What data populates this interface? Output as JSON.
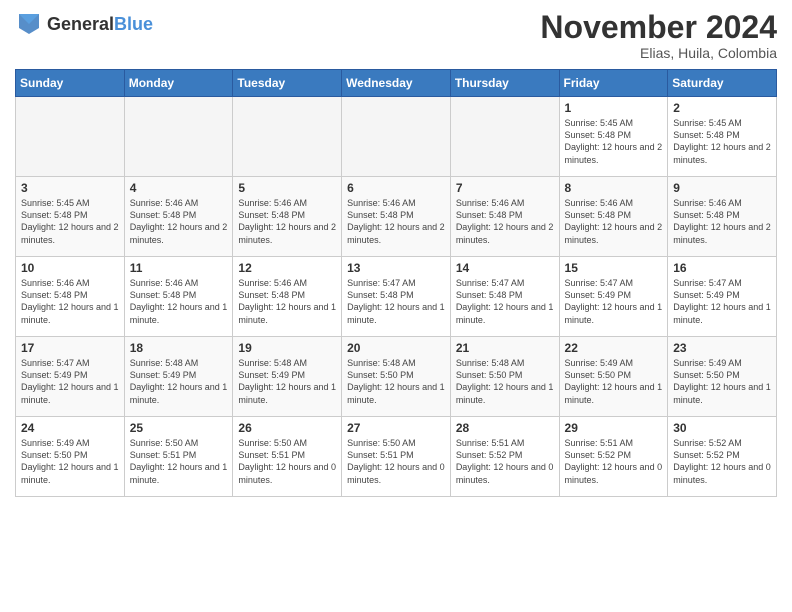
{
  "header": {
    "logo_general": "General",
    "logo_blue": "Blue",
    "month_title": "November 2024",
    "subtitle": "Elias, Huila, Colombia"
  },
  "days_of_week": [
    "Sunday",
    "Monday",
    "Tuesday",
    "Wednesday",
    "Thursday",
    "Friday",
    "Saturday"
  ],
  "weeks": [
    [
      {
        "day": "",
        "info": ""
      },
      {
        "day": "",
        "info": ""
      },
      {
        "day": "",
        "info": ""
      },
      {
        "day": "",
        "info": ""
      },
      {
        "day": "",
        "info": ""
      },
      {
        "day": "1",
        "info": "Sunrise: 5:45 AM\nSunset: 5:48 PM\nDaylight: 12 hours and 2 minutes."
      },
      {
        "day": "2",
        "info": "Sunrise: 5:45 AM\nSunset: 5:48 PM\nDaylight: 12 hours and 2 minutes."
      }
    ],
    [
      {
        "day": "3",
        "info": "Sunrise: 5:45 AM\nSunset: 5:48 PM\nDaylight: 12 hours and 2 minutes."
      },
      {
        "day": "4",
        "info": "Sunrise: 5:46 AM\nSunset: 5:48 PM\nDaylight: 12 hours and 2 minutes."
      },
      {
        "day": "5",
        "info": "Sunrise: 5:46 AM\nSunset: 5:48 PM\nDaylight: 12 hours and 2 minutes."
      },
      {
        "day": "6",
        "info": "Sunrise: 5:46 AM\nSunset: 5:48 PM\nDaylight: 12 hours and 2 minutes."
      },
      {
        "day": "7",
        "info": "Sunrise: 5:46 AM\nSunset: 5:48 PM\nDaylight: 12 hours and 2 minutes."
      },
      {
        "day": "8",
        "info": "Sunrise: 5:46 AM\nSunset: 5:48 PM\nDaylight: 12 hours and 2 minutes."
      },
      {
        "day": "9",
        "info": "Sunrise: 5:46 AM\nSunset: 5:48 PM\nDaylight: 12 hours and 2 minutes."
      }
    ],
    [
      {
        "day": "10",
        "info": "Sunrise: 5:46 AM\nSunset: 5:48 PM\nDaylight: 12 hours and 1 minute."
      },
      {
        "day": "11",
        "info": "Sunrise: 5:46 AM\nSunset: 5:48 PM\nDaylight: 12 hours and 1 minute."
      },
      {
        "day": "12",
        "info": "Sunrise: 5:46 AM\nSunset: 5:48 PM\nDaylight: 12 hours and 1 minute."
      },
      {
        "day": "13",
        "info": "Sunrise: 5:47 AM\nSunset: 5:48 PM\nDaylight: 12 hours and 1 minute."
      },
      {
        "day": "14",
        "info": "Sunrise: 5:47 AM\nSunset: 5:48 PM\nDaylight: 12 hours and 1 minute."
      },
      {
        "day": "15",
        "info": "Sunrise: 5:47 AM\nSunset: 5:49 PM\nDaylight: 12 hours and 1 minute."
      },
      {
        "day": "16",
        "info": "Sunrise: 5:47 AM\nSunset: 5:49 PM\nDaylight: 12 hours and 1 minute."
      }
    ],
    [
      {
        "day": "17",
        "info": "Sunrise: 5:47 AM\nSunset: 5:49 PM\nDaylight: 12 hours and 1 minute."
      },
      {
        "day": "18",
        "info": "Sunrise: 5:48 AM\nSunset: 5:49 PM\nDaylight: 12 hours and 1 minute."
      },
      {
        "day": "19",
        "info": "Sunrise: 5:48 AM\nSunset: 5:49 PM\nDaylight: 12 hours and 1 minute."
      },
      {
        "day": "20",
        "info": "Sunrise: 5:48 AM\nSunset: 5:50 PM\nDaylight: 12 hours and 1 minute."
      },
      {
        "day": "21",
        "info": "Sunrise: 5:48 AM\nSunset: 5:50 PM\nDaylight: 12 hours and 1 minute."
      },
      {
        "day": "22",
        "info": "Sunrise: 5:49 AM\nSunset: 5:50 PM\nDaylight: 12 hours and 1 minute."
      },
      {
        "day": "23",
        "info": "Sunrise: 5:49 AM\nSunset: 5:50 PM\nDaylight: 12 hours and 1 minute."
      }
    ],
    [
      {
        "day": "24",
        "info": "Sunrise: 5:49 AM\nSunset: 5:50 PM\nDaylight: 12 hours and 1 minute."
      },
      {
        "day": "25",
        "info": "Sunrise: 5:50 AM\nSunset: 5:51 PM\nDaylight: 12 hours and 1 minute."
      },
      {
        "day": "26",
        "info": "Sunrise: 5:50 AM\nSunset: 5:51 PM\nDaylight: 12 hours and 0 minutes."
      },
      {
        "day": "27",
        "info": "Sunrise: 5:50 AM\nSunset: 5:51 PM\nDaylight: 12 hours and 0 minutes."
      },
      {
        "day": "28",
        "info": "Sunrise: 5:51 AM\nSunset: 5:52 PM\nDaylight: 12 hours and 0 minutes."
      },
      {
        "day": "29",
        "info": "Sunrise: 5:51 AM\nSunset: 5:52 PM\nDaylight: 12 hours and 0 minutes."
      },
      {
        "day": "30",
        "info": "Sunrise: 5:52 AM\nSunset: 5:52 PM\nDaylight: 12 hours and 0 minutes."
      }
    ]
  ]
}
